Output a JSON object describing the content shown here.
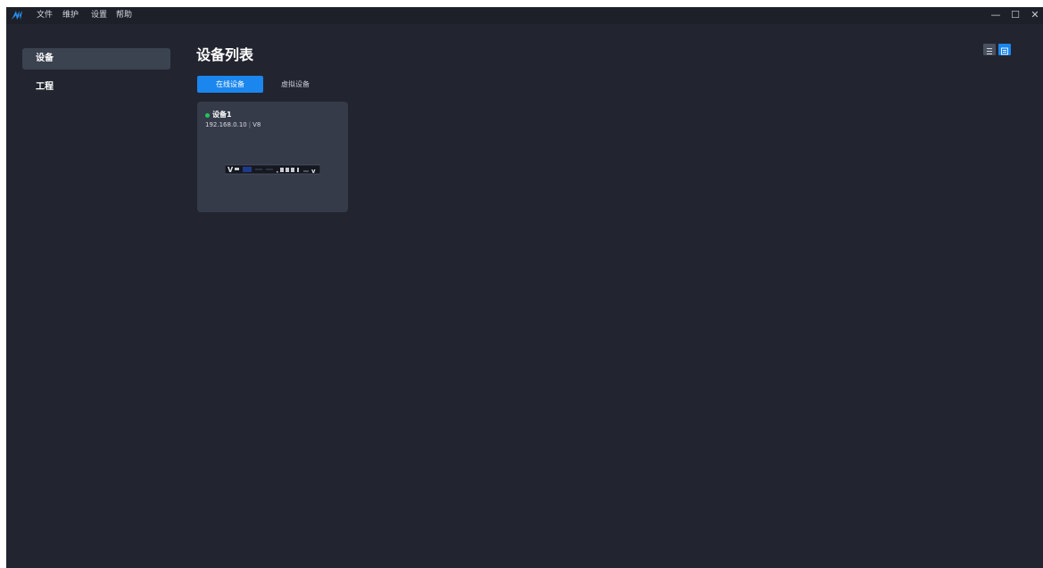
{
  "menu": {
    "items": [
      {
        "label": "文件"
      },
      {
        "label": "维护"
      },
      {
        "label": "设置"
      },
      {
        "label": "帮助"
      }
    ]
  },
  "window_controls": {
    "minimize": "—",
    "maximize": "☐",
    "close": "✕"
  },
  "sidebar": {
    "items": [
      {
        "label": "设备",
        "active": true
      },
      {
        "label": "工程",
        "active": false
      }
    ]
  },
  "main": {
    "title": "设备列表",
    "tabs": [
      {
        "label": "在线设备",
        "active": true
      },
      {
        "label": "虚拟设备",
        "active": false
      }
    ],
    "view_modes": [
      {
        "icon": "list-icon",
        "active": false
      },
      {
        "icon": "grid-icon",
        "active": true
      }
    ]
  },
  "devices": [
    {
      "name": "设备1",
      "ip": "192.168.0.10",
      "separator": "|",
      "model": "V8",
      "status": "online",
      "status_color": "#22c55e"
    }
  ],
  "colors": {
    "accent": "#1a86ee",
    "background": "#22252f",
    "titlebar": "#1d2028",
    "card": "#353b49",
    "sidebar_active": "#3b4250"
  }
}
